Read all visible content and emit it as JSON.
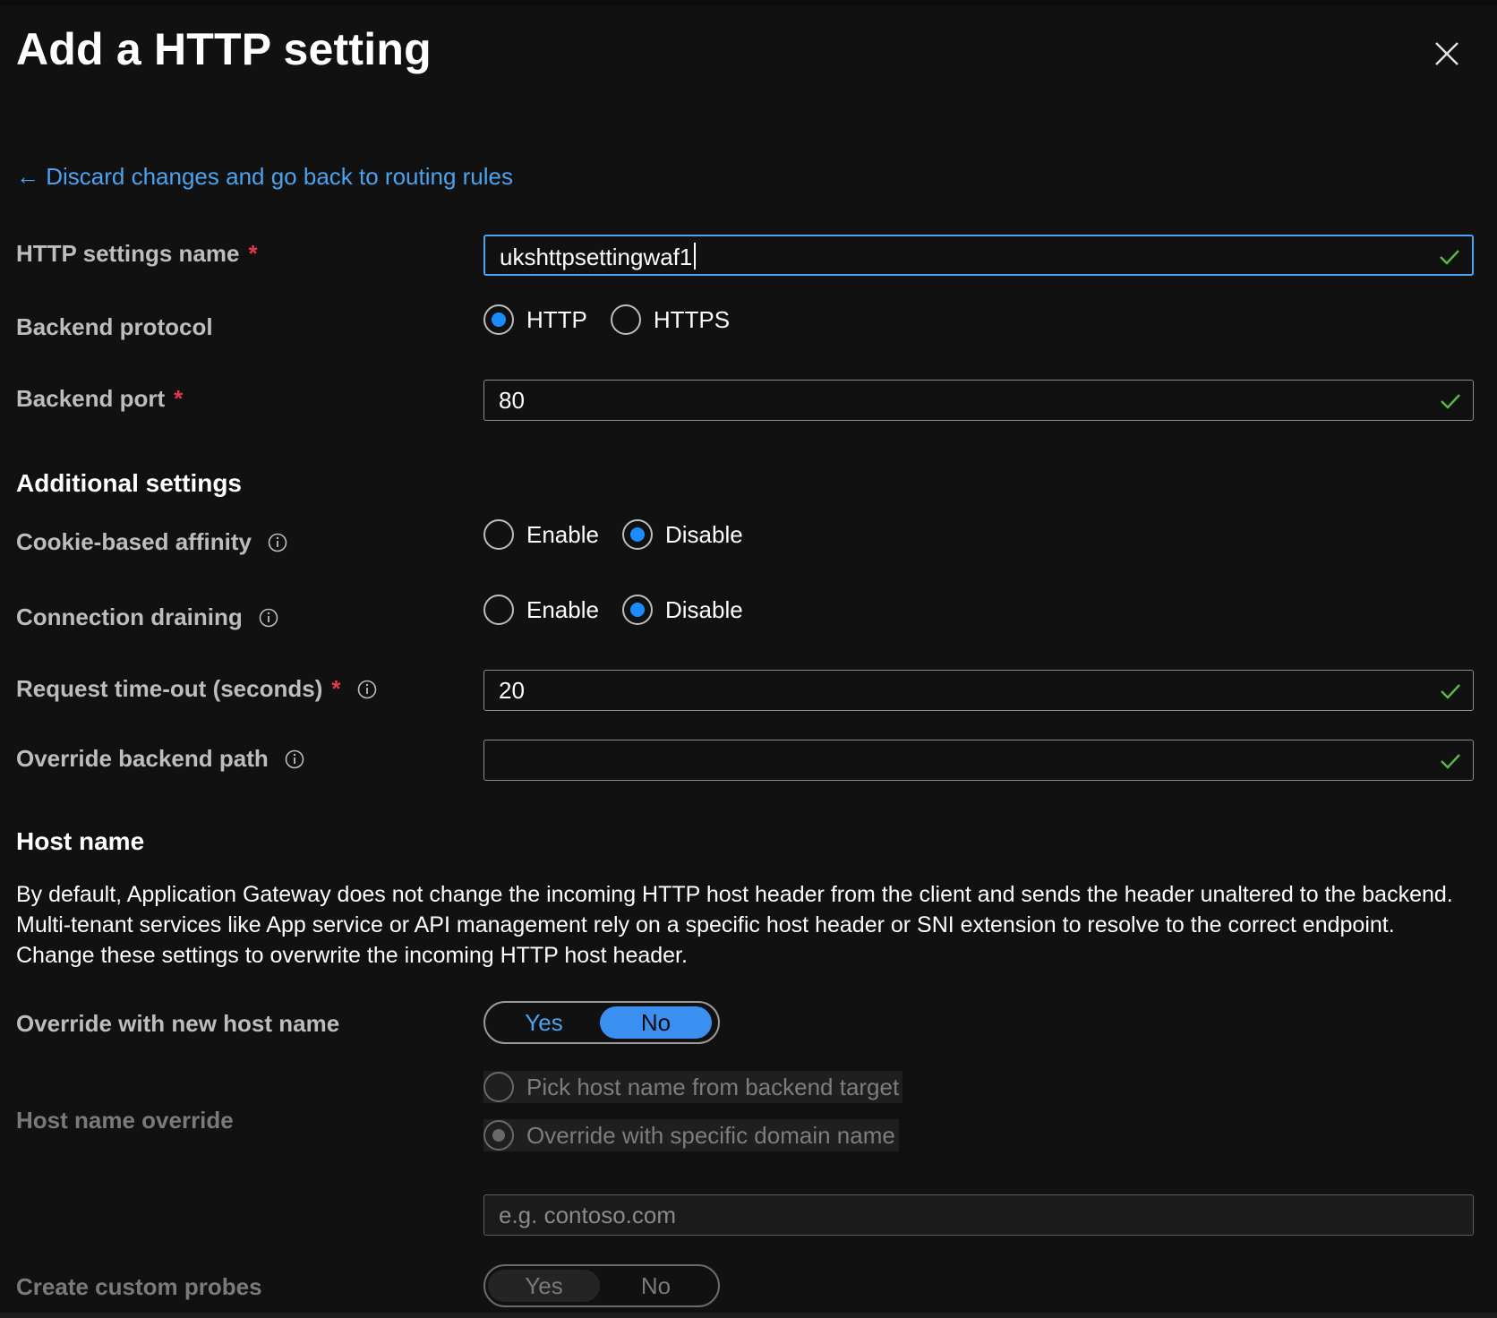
{
  "header": {
    "title": "Add a HTTP setting",
    "close_icon": "close-icon"
  },
  "back_link": {
    "arrow": "←",
    "text": "Discard changes and go back to routing rules"
  },
  "form": {
    "required_marker": "*",
    "http_settings_name": {
      "label": "HTTP settings name",
      "value": "ukshttpsettingwaf1",
      "valid": true
    },
    "backend_protocol": {
      "label": "Backend protocol",
      "options": [
        "HTTP",
        "HTTPS"
      ],
      "selected": "HTTP"
    },
    "backend_port": {
      "label": "Backend port",
      "value": "80",
      "valid": true
    }
  },
  "additional": {
    "heading": "Additional settings",
    "cookie_affinity": {
      "label": "Cookie-based affinity",
      "options": [
        "Enable",
        "Disable"
      ],
      "selected": "Disable"
    },
    "connection_draining": {
      "label": "Connection draining",
      "options": [
        "Enable",
        "Disable"
      ],
      "selected": "Disable"
    },
    "request_timeout": {
      "label": "Request time-out (seconds)",
      "value": "20",
      "valid": true
    },
    "override_backend_path": {
      "label": "Override backend path",
      "value": "",
      "valid": true
    }
  },
  "host_name": {
    "heading": "Host name",
    "description": "By default, Application Gateway does not change the incoming HTTP host header from the client and sends the header unaltered to the backend. Multi-tenant services like App service or API management rely on a specific host header or SNI extension to resolve to the correct endpoint. Change these settings to overwrite the incoming HTTP host header.",
    "override_new_host": {
      "label": "Override with new host name",
      "yes": "Yes",
      "no": "No",
      "selected": "No"
    },
    "host_name_override": {
      "label": "Host name override",
      "options": [
        "Pick host name from backend target",
        "Override with specific domain name"
      ],
      "selected": "Override with specific domain name",
      "disabled": true
    },
    "domain_input": {
      "placeholder": "e.g. contoso.com",
      "disabled": true
    },
    "custom_probes": {
      "label": "Create custom probes",
      "yes": "Yes",
      "no": "No",
      "disabled": true
    }
  },
  "colors": {
    "accent": "#1a8cff",
    "link": "#4aa3f0",
    "required": "#e0394a",
    "valid": "#5db84a",
    "background": "#111111"
  }
}
